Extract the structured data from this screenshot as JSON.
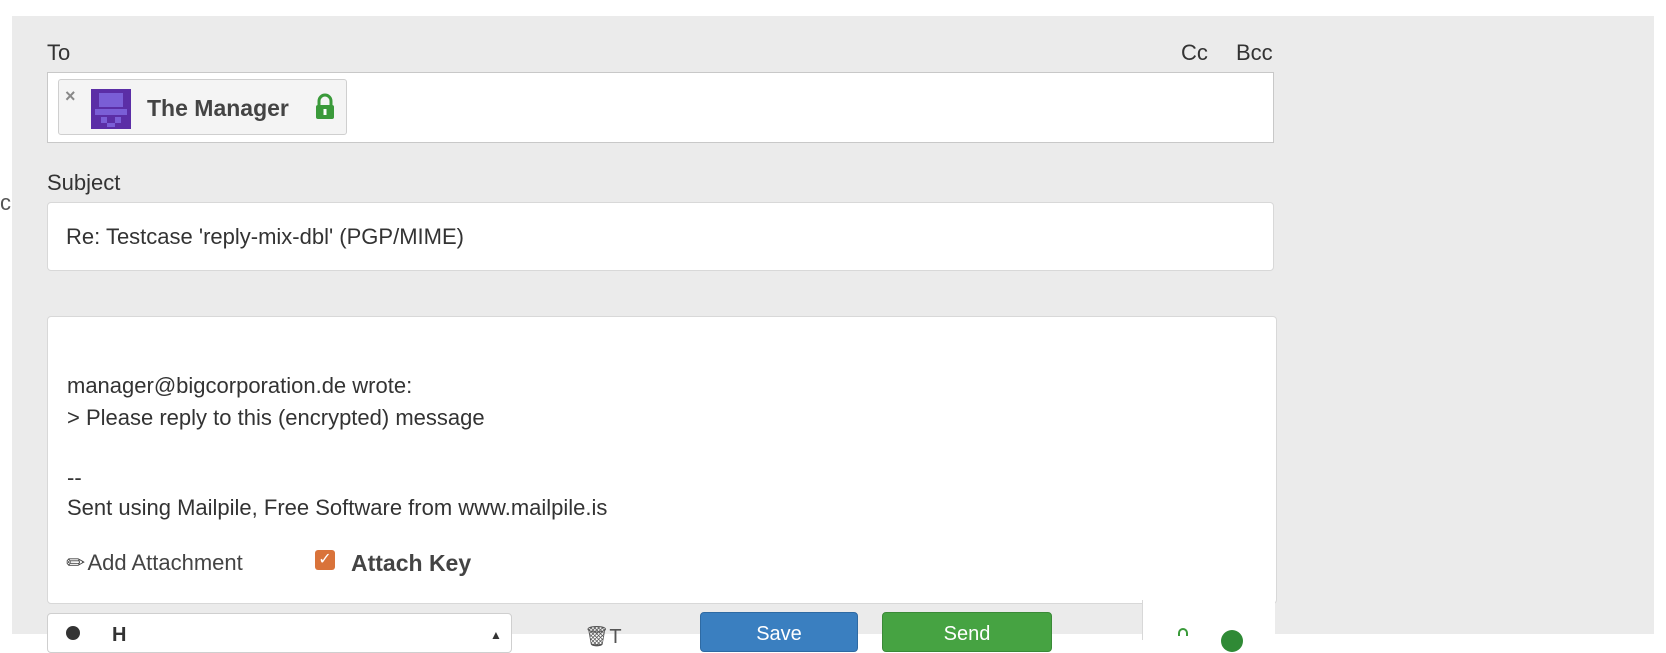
{
  "stray_text": "c",
  "to": {
    "label": "To",
    "cc_label": "Cc",
    "bcc_label": "Bcc",
    "recipient": {
      "remove": "×",
      "name": "The Manager",
      "encrypted_icon": "lock-icon",
      "avatar_icon": "identicon-avatar"
    }
  },
  "subject": {
    "label": "Subject",
    "value": "Re: Testcase 'reply-mix-dbl' (PGP/MIME)"
  },
  "body": {
    "lines": [
      "manager@bigcorporation.de wrote:",
      "> Please reply to this (encrypted) message",
      "--",
      "Sent using Mailpile, Free Software from www.mailpile.is"
    ]
  },
  "attachments": {
    "add_label": "Add Attachment",
    "attach_key_label": "Attach Key",
    "attach_key_checked": true
  },
  "toolbar": {
    "from_text": "H",
    "trash_text": "T",
    "save_label": "Save",
    "send_label": "Send"
  },
  "colors": {
    "panel_bg": "#ebebeb",
    "avatar": "#5b2ea6",
    "lock_green": "#3a9a3a",
    "checkbox": "#d9733a",
    "save_button": "#3a7fc0",
    "send_button": "#46a342"
  }
}
